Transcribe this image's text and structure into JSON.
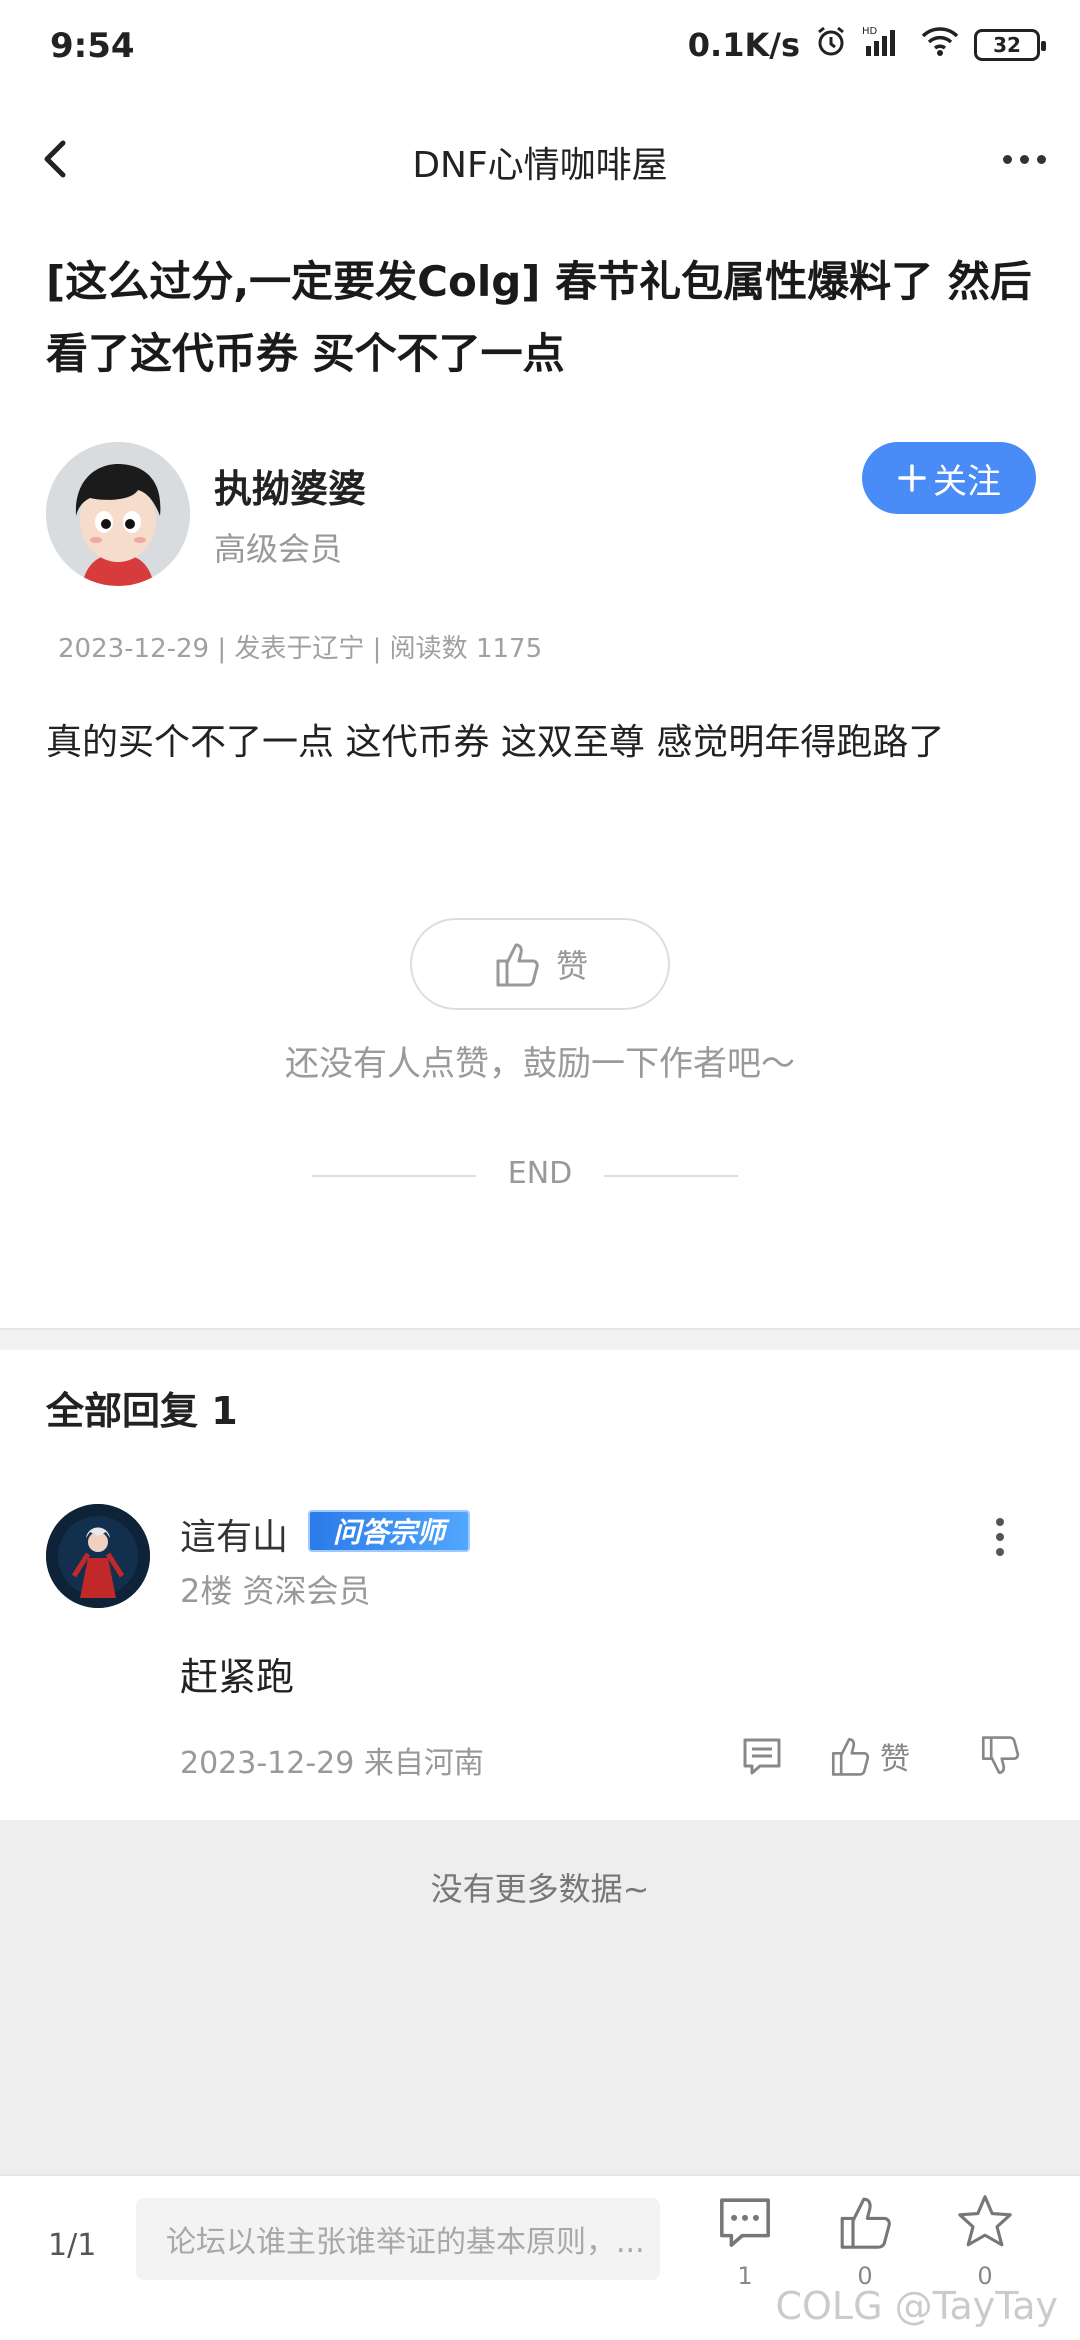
{
  "status_bar": {
    "time": "9:54",
    "network_speed": "0.1K/s",
    "battery": "32"
  },
  "header": {
    "title": "DNF心情咖啡屋"
  },
  "post": {
    "title": "[这么过分,一定要发Colg] 春节礼包属性爆料了 然后看了这代币券 买个不了一点",
    "author_name": "执拗婆婆",
    "author_level": "高级会员",
    "follow_label": "关注",
    "meta": "2023-12-29 | 发表于辽宁 | 阅读数 1175",
    "body": "真的买个不了一点 这代币券 这双至尊 感觉明年得跑路了",
    "like_label": "赞",
    "like_hint": "还没有人点赞，鼓励一下作者吧～",
    "end_label": "END"
  },
  "replies": {
    "header": "全部回复  1",
    "items": [
      {
        "name": "這有山",
        "badge": "问答宗师",
        "floor_level": "2楼 资深会员",
        "text": "赶紧跑",
        "time_location": "2023-12-29 来自河南",
        "like_label": "赞"
      }
    ],
    "no_more": "没有更多数据~"
  },
  "bottom_bar": {
    "page": "1/1",
    "input_placeholder": "论坛以谁主张谁举证的基本原则，...",
    "comment_count": "1",
    "like_count": "0",
    "favorite_count": "0",
    "watermark": "COLG @TayTay"
  },
  "colors": {
    "accent": "#4a8cf7",
    "badge": "#2b7be8"
  }
}
